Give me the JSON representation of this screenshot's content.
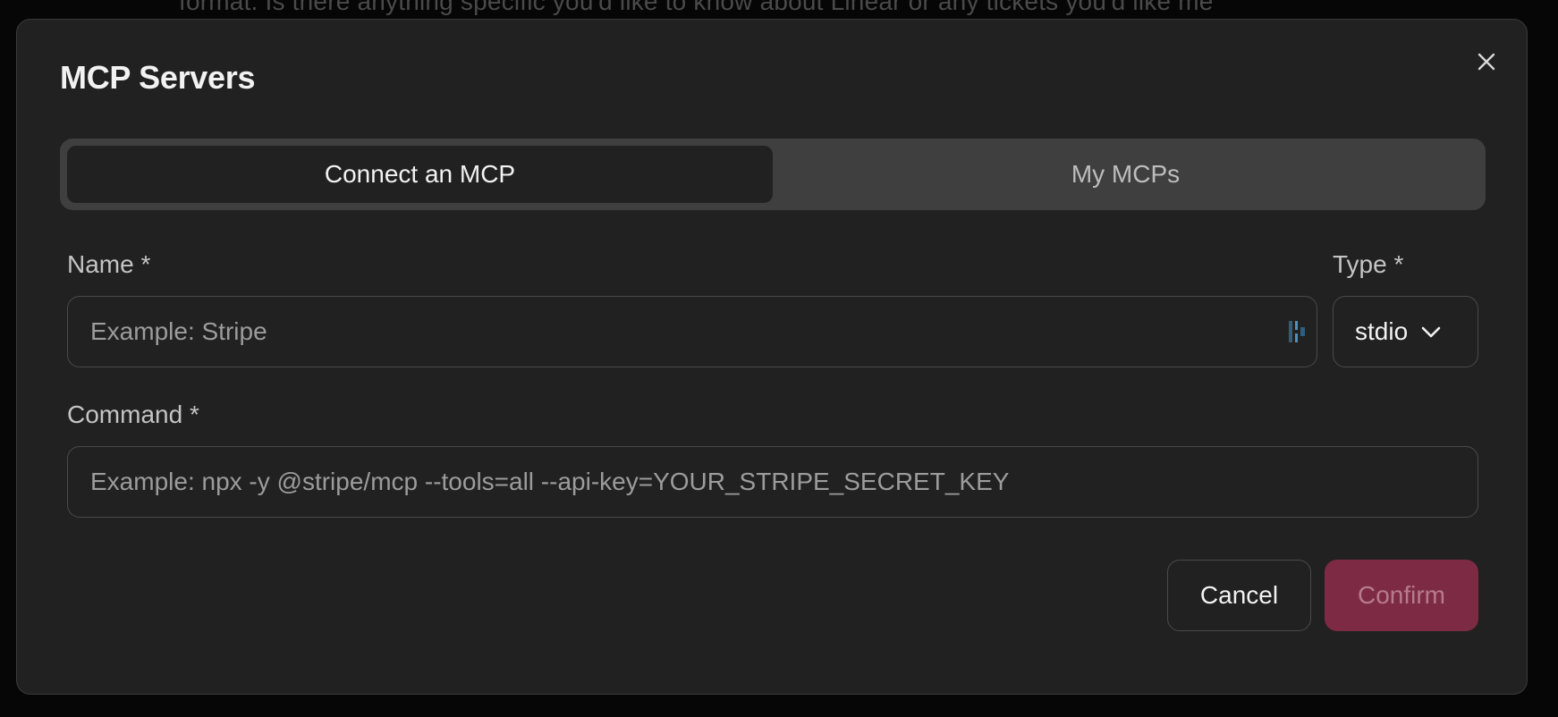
{
  "background": {
    "text": "format. Is there anything specific you'd like to know about Linear or any tickets you'd like me"
  },
  "modal": {
    "title": "MCP Servers"
  },
  "tabs": [
    {
      "label": "Connect an MCP",
      "active": true
    },
    {
      "label": "My MCPs",
      "active": false
    }
  ],
  "form": {
    "name": {
      "label": "Name *",
      "value": "",
      "placeholder": "Example: Stripe"
    },
    "type": {
      "label": "Type *",
      "selected": "stdio"
    },
    "command": {
      "label": "Command *",
      "value": "",
      "placeholder": "Example: npx -y @stripe/mcp --tools=all --api-key=YOUR_STRIPE_SECRET_KEY"
    }
  },
  "actions": {
    "cancel_label": "Cancel",
    "confirm_label": "Confirm"
  },
  "icons": {
    "close": "close-icon",
    "chevron": "chevron-down-icon",
    "password_manager": "password-manager-icon"
  },
  "colors": {
    "modal_bg": "#212121",
    "confirm_bg": "#7d2b44",
    "confirm_text": "#b77b8d",
    "password_icon": "#4f8fb8"
  }
}
